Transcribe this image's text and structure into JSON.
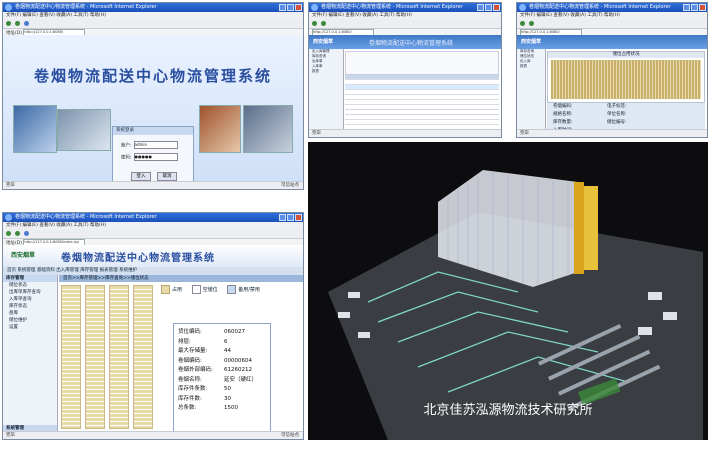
{
  "browser": {
    "window_title": "卷烟物流配送中心物流管理系统 - Microsoft Internet Explorer",
    "menu": "文件(F)  编辑(E)  查看(V)  收藏(A)  工具(T)  帮助(H)",
    "address_label": "地址(D)",
    "address_value": "http://127.0.0.1:8080/",
    "address_value_4": "http://127.0.0.1:8080/index.jsp",
    "status_done": "完毕",
    "status_zone": "可信站点"
  },
  "login_screen": {
    "system_title": "卷烟物流配送中心物流管理系统",
    "box_title": "系统登录",
    "user_label": "账户:",
    "user_value": "admin",
    "password_label": "密码:",
    "password_value": "●●●●●",
    "login_button": "登入",
    "cancel_button": "取消"
  },
  "grid_screen": {
    "logo": "西安烟草",
    "title": "卷烟物流配送中心物流管理系统",
    "tree_items": [
      "出入库管理",
      "库存查询",
      "出库单",
      "入库单",
      "报表"
    ]
  },
  "chart_screen": {
    "logo": "西安烟草",
    "title": "卷烟物流配送中心物流管理系统",
    "chart_title": "储位占用状况",
    "tree_items": [
      "库存查询",
      "储位状态",
      "出入库",
      "报表"
    ],
    "info": [
      {
        "label": "卷烟编码:",
        "value": "电子标签:"
      },
      {
        "label": "规格名称:",
        "value": "单位名称:"
      },
      {
        "label": "库存数量:",
        "value": "储位编号:"
      },
      {
        "label": "入库时间:",
        "value": ""
      }
    ]
  },
  "warehouse_screen": {
    "logo": "西安烟草",
    "title": "卷烟物流配送中心物流管理系统",
    "nav": "首页  系统管理  基础资料  出入库管理  库存管理  报表管理  系统维护",
    "crumb": "首页>>库存管理>>库存查询>>储位状态",
    "tree_items": [
      {
        "label": "库存管理",
        "section": true
      },
      {
        "label": "储位状态",
        "section": false
      },
      {
        "label": "出库单库存查询",
        "section": false
      },
      {
        "label": "入库单查询",
        "section": false
      },
      {
        "label": "库存状态",
        "section": false
      },
      {
        "label": "盘库",
        "section": false
      },
      {
        "label": "储位维护",
        "section": false
      },
      {
        "label": "设置",
        "section": false
      }
    ],
    "bottom_tree": "系统管理",
    "legend_occupied": "占用",
    "legend_empty": "空储位",
    "legend_other": "备用/禁用",
    "details": [
      {
        "label": "货位编码:",
        "value": "060027"
      },
      {
        "label": "排层:",
        "value": "6"
      },
      {
        "label": "最大存储量:",
        "value": "44"
      },
      {
        "label": "卷烟编码:",
        "value": "00000604"
      },
      {
        "label": "卷烟外部编码:",
        "value": "61260212"
      },
      {
        "label": "卷烟名称:",
        "value": "延安（硬红）"
      },
      {
        "label": "库存件条数:",
        "value": "50"
      },
      {
        "label": "库存件数:",
        "value": "30"
      },
      {
        "label": "总条数:",
        "value": "1500"
      }
    ]
  },
  "render": {
    "caption": "北京佳苏泓源物流技术研究所"
  },
  "colors": {
    "ie_blue": "#1b4fb8",
    "header_blue": "#3e78c6",
    "title_blue": "#2a4fa0",
    "rack_tan": "#e8d9a8",
    "render_bg": "#0d0d0f"
  }
}
